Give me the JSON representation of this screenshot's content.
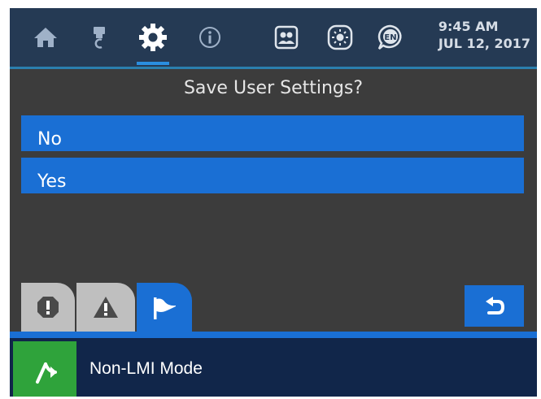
{
  "header": {
    "time": "9:45 AM",
    "date": "JUL 12, 2017",
    "language_code": "EN",
    "nav_icons": [
      "home-icon",
      "wrench-icon",
      "gear-icon",
      "info-icon",
      "users-icon",
      "brightness-icon",
      "language-icon"
    ],
    "active_tab": "gear-icon"
  },
  "dialog": {
    "title": "Save User Settings?",
    "options": [
      "No",
      "Yes"
    ]
  },
  "tabs": {
    "items": [
      "critical-alert-icon",
      "warning-icon",
      "flag-icon"
    ],
    "active": "flag-icon"
  },
  "status": {
    "mode_label": "Non-LMI Mode"
  },
  "colors": {
    "accent_blue": "#1a6fd4",
    "header_bg": "#253a54",
    "body_bg": "#3c3c3c",
    "status_bg": "#11264a",
    "mode_green": "#2fa33b"
  }
}
